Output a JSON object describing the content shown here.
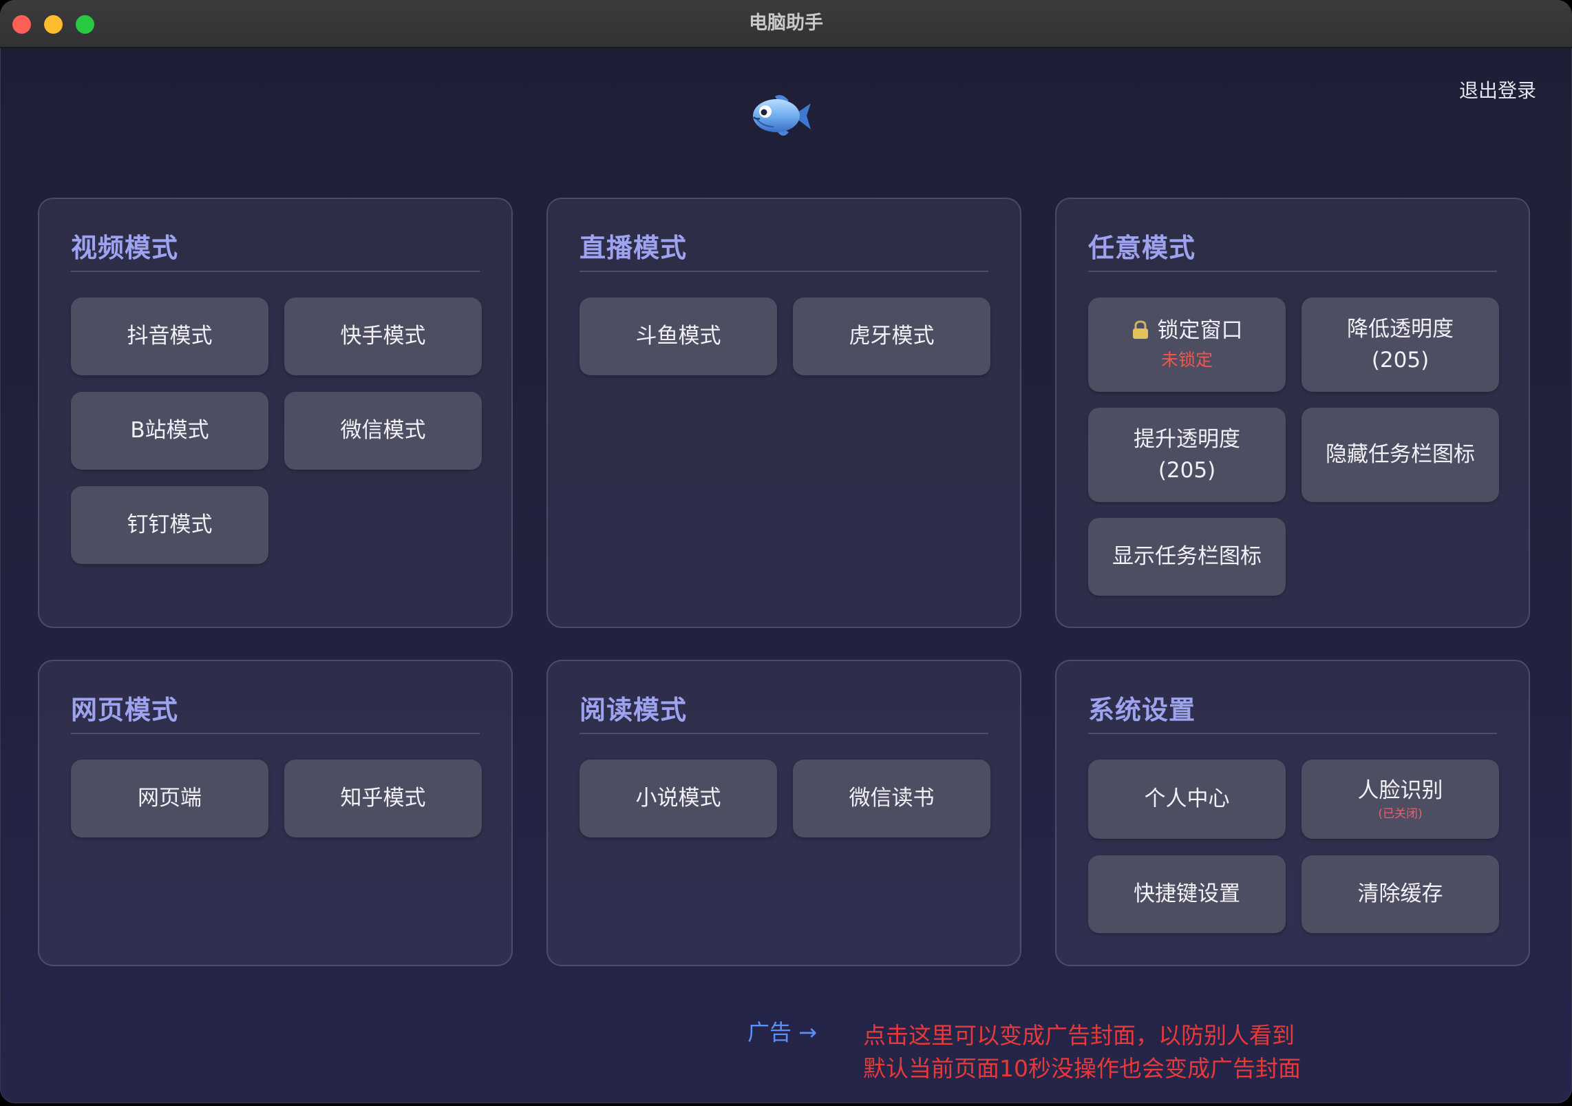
{
  "window": {
    "title": "电脑助手"
  },
  "header": {
    "logout_label": "退出登录",
    "logo_icon": "fish-icon"
  },
  "panels": {
    "video": {
      "title": "视频模式",
      "buttons": [
        "抖音模式",
        "快手模式",
        "B站模式",
        "微信模式",
        "钉钉模式"
      ]
    },
    "live": {
      "title": "直播模式",
      "buttons": [
        "斗鱼模式",
        "虎牙模式"
      ]
    },
    "any": {
      "title": "任意模式",
      "lock": {
        "icon": "lock-icon",
        "label": "锁定窗口",
        "status": "未锁定"
      },
      "decrease_opacity": {
        "label": "降低透明度",
        "value": "(205)"
      },
      "increase_opacity": {
        "label": "提升透明度",
        "value": "(205)"
      },
      "hide_taskbar": "隐藏任务栏图标",
      "show_taskbar": "显示任务栏图标"
    },
    "web": {
      "title": "网页模式",
      "buttons": [
        "网页端",
        "知乎模式"
      ]
    },
    "reading": {
      "title": "阅读模式",
      "buttons": [
        "小说模式",
        "微信读书"
      ]
    },
    "settings": {
      "title": "系统设置",
      "personal_center": "个人中心",
      "face_recognition": {
        "label": "人脸识别",
        "status": "(已关闭)"
      },
      "shortcut_settings": "快捷键设置",
      "clear_cache": "清除缓存"
    }
  },
  "footer": {
    "ad_link": "广告 →",
    "note_line1": "点击这里可以变成广告封面，以防别人看到",
    "note_line2": "默认当前页面10秒没操作也会变成广告封面"
  },
  "colors": {
    "panel_title": "#9ea3f0",
    "lock_status": "#f2554d",
    "ad_link": "#5b8ff5",
    "ad_note": "#e8393a"
  }
}
